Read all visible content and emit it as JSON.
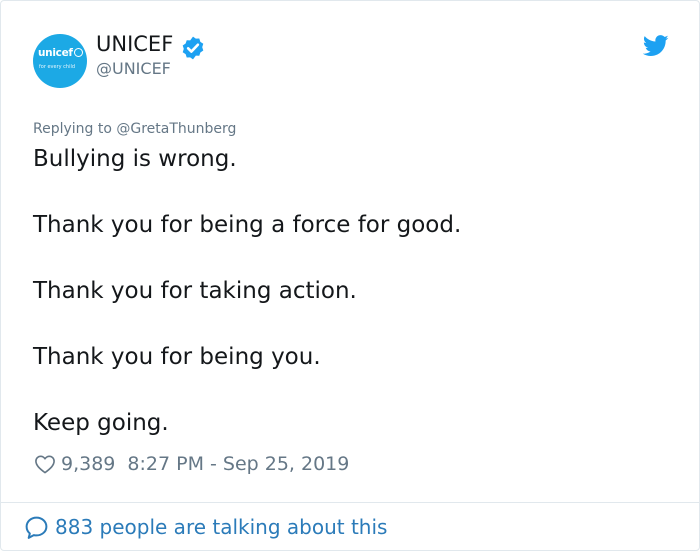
{
  "account": {
    "name": "UNICEF",
    "handle": "@UNICEF",
    "avatar_brand": "unicef",
    "avatar_tagline": "for every child",
    "verified": true
  },
  "tweet": {
    "replying_to": "Replying to @GretaThunberg",
    "lines": [
      "Bullying is wrong.",
      "Thank you for being a force for good.",
      "Thank you for taking action.",
      "Thank you for being you.",
      "Keep going."
    ],
    "likes": "9,389",
    "timestamp": "8:27 PM - Sep 25, 2019"
  },
  "footer": {
    "talking": "883 people are talking about this"
  },
  "icons": {
    "verified": "verified-badge-icon",
    "brand": "twitter-bird-icon",
    "like": "heart-icon",
    "conversation": "speech-bubble-icon"
  },
  "colors": {
    "twitter_blue": "#1da1f2",
    "link_blue": "#2b7bb9",
    "text": "#14171a",
    "muted": "#657786",
    "unicef_blue": "#1ca9e5",
    "border": "#e1e8ed"
  }
}
